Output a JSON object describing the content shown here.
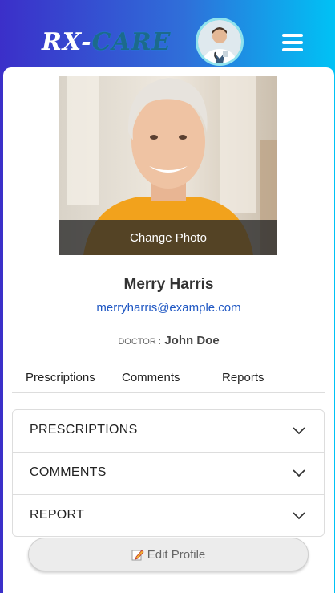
{
  "header": {
    "logo_part1": "RX-",
    "logo_part2": "CARE"
  },
  "profile": {
    "change_photo_label": "Change Photo",
    "name": "Merry Harris",
    "email": "merryharris@example.com",
    "doctor_label": "DOCTOR :",
    "doctor_name": "John Doe"
  },
  "tabs": [
    {
      "label": "Prescriptions"
    },
    {
      "label": "Comments"
    },
    {
      "label": "Reports"
    }
  ],
  "accordion": [
    {
      "label": "PRESCRIPTIONS",
      "icon": "chevron-down-icon"
    },
    {
      "label": "COMMENTS",
      "icon": "chevron-down-icon"
    },
    {
      "label": "REPORT",
      "icon": "chevron-down-icon"
    }
  ],
  "actions": {
    "edit_profile_label": "Edit Profile",
    "edit_icon": "edit-icon"
  },
  "colors": {
    "header_gradient_start": "#3b2fc9",
    "header_gradient_end": "#00c2f5",
    "link": "#1f57c3"
  }
}
